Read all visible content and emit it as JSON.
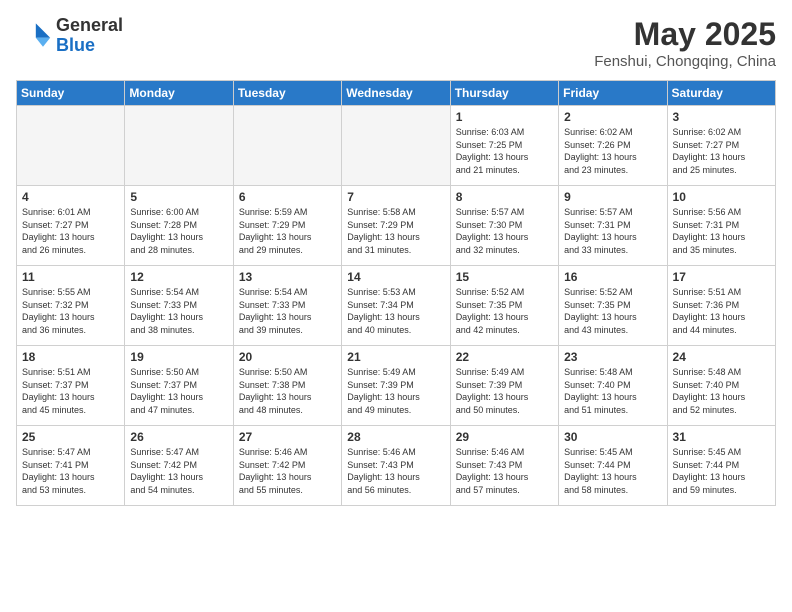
{
  "logo": {
    "general": "General",
    "blue": "Blue"
  },
  "header": {
    "title": "May 2025",
    "subtitle": "Fenshui, Chongqing, China"
  },
  "weekdays": [
    "Sunday",
    "Monday",
    "Tuesday",
    "Wednesday",
    "Thursday",
    "Friday",
    "Saturday"
  ],
  "weeks": [
    [
      {
        "day": "",
        "empty": true
      },
      {
        "day": "",
        "empty": true
      },
      {
        "day": "",
        "empty": true
      },
      {
        "day": "",
        "empty": true
      },
      {
        "day": "1",
        "sunrise": "6:03 AM",
        "sunset": "7:25 PM",
        "daylight": "13 hours and 21 minutes."
      },
      {
        "day": "2",
        "sunrise": "6:02 AM",
        "sunset": "7:26 PM",
        "daylight": "13 hours and 23 minutes."
      },
      {
        "day": "3",
        "sunrise": "6:02 AM",
        "sunset": "7:27 PM",
        "daylight": "13 hours and 25 minutes."
      }
    ],
    [
      {
        "day": "4",
        "sunrise": "6:01 AM",
        "sunset": "7:27 PM",
        "daylight": "13 hours and 26 minutes."
      },
      {
        "day": "5",
        "sunrise": "6:00 AM",
        "sunset": "7:28 PM",
        "daylight": "13 hours and 28 minutes."
      },
      {
        "day": "6",
        "sunrise": "5:59 AM",
        "sunset": "7:29 PM",
        "daylight": "13 hours and 29 minutes."
      },
      {
        "day": "7",
        "sunrise": "5:58 AM",
        "sunset": "7:29 PM",
        "daylight": "13 hours and 31 minutes."
      },
      {
        "day": "8",
        "sunrise": "5:57 AM",
        "sunset": "7:30 PM",
        "daylight": "13 hours and 32 minutes."
      },
      {
        "day": "9",
        "sunrise": "5:57 AM",
        "sunset": "7:31 PM",
        "daylight": "13 hours and 33 minutes."
      },
      {
        "day": "10",
        "sunrise": "5:56 AM",
        "sunset": "7:31 PM",
        "daylight": "13 hours and 35 minutes."
      }
    ],
    [
      {
        "day": "11",
        "sunrise": "5:55 AM",
        "sunset": "7:32 PM",
        "daylight": "13 hours and 36 minutes."
      },
      {
        "day": "12",
        "sunrise": "5:54 AM",
        "sunset": "7:33 PM",
        "daylight": "13 hours and 38 minutes."
      },
      {
        "day": "13",
        "sunrise": "5:54 AM",
        "sunset": "7:33 PM",
        "daylight": "13 hours and 39 minutes."
      },
      {
        "day": "14",
        "sunrise": "5:53 AM",
        "sunset": "7:34 PM",
        "daylight": "13 hours and 40 minutes."
      },
      {
        "day": "15",
        "sunrise": "5:52 AM",
        "sunset": "7:35 PM",
        "daylight": "13 hours and 42 minutes."
      },
      {
        "day": "16",
        "sunrise": "5:52 AM",
        "sunset": "7:35 PM",
        "daylight": "13 hours and 43 minutes."
      },
      {
        "day": "17",
        "sunrise": "5:51 AM",
        "sunset": "7:36 PM",
        "daylight": "13 hours and 44 minutes."
      }
    ],
    [
      {
        "day": "18",
        "sunrise": "5:51 AM",
        "sunset": "7:37 PM",
        "daylight": "13 hours and 45 minutes."
      },
      {
        "day": "19",
        "sunrise": "5:50 AM",
        "sunset": "7:37 PM",
        "daylight": "13 hours and 47 minutes."
      },
      {
        "day": "20",
        "sunrise": "5:50 AM",
        "sunset": "7:38 PM",
        "daylight": "13 hours and 48 minutes."
      },
      {
        "day": "21",
        "sunrise": "5:49 AM",
        "sunset": "7:39 PM",
        "daylight": "13 hours and 49 minutes."
      },
      {
        "day": "22",
        "sunrise": "5:49 AM",
        "sunset": "7:39 PM",
        "daylight": "13 hours and 50 minutes."
      },
      {
        "day": "23",
        "sunrise": "5:48 AM",
        "sunset": "7:40 PM",
        "daylight": "13 hours and 51 minutes."
      },
      {
        "day": "24",
        "sunrise": "5:48 AM",
        "sunset": "7:40 PM",
        "daylight": "13 hours and 52 minutes."
      }
    ],
    [
      {
        "day": "25",
        "sunrise": "5:47 AM",
        "sunset": "7:41 PM",
        "daylight": "13 hours and 53 minutes."
      },
      {
        "day": "26",
        "sunrise": "5:47 AM",
        "sunset": "7:42 PM",
        "daylight": "13 hours and 54 minutes."
      },
      {
        "day": "27",
        "sunrise": "5:46 AM",
        "sunset": "7:42 PM",
        "daylight": "13 hours and 55 minutes."
      },
      {
        "day": "28",
        "sunrise": "5:46 AM",
        "sunset": "7:43 PM",
        "daylight": "13 hours and 56 minutes."
      },
      {
        "day": "29",
        "sunrise": "5:46 AM",
        "sunset": "7:43 PM",
        "daylight": "13 hours and 57 minutes."
      },
      {
        "day": "30",
        "sunrise": "5:45 AM",
        "sunset": "7:44 PM",
        "daylight": "13 hours and 58 minutes."
      },
      {
        "day": "31",
        "sunrise": "5:45 AM",
        "sunset": "7:44 PM",
        "daylight": "13 hours and 59 minutes."
      }
    ]
  ],
  "labels": {
    "sunrise": "Sunrise:",
    "sunset": "Sunset:",
    "daylight": "Daylight:"
  }
}
